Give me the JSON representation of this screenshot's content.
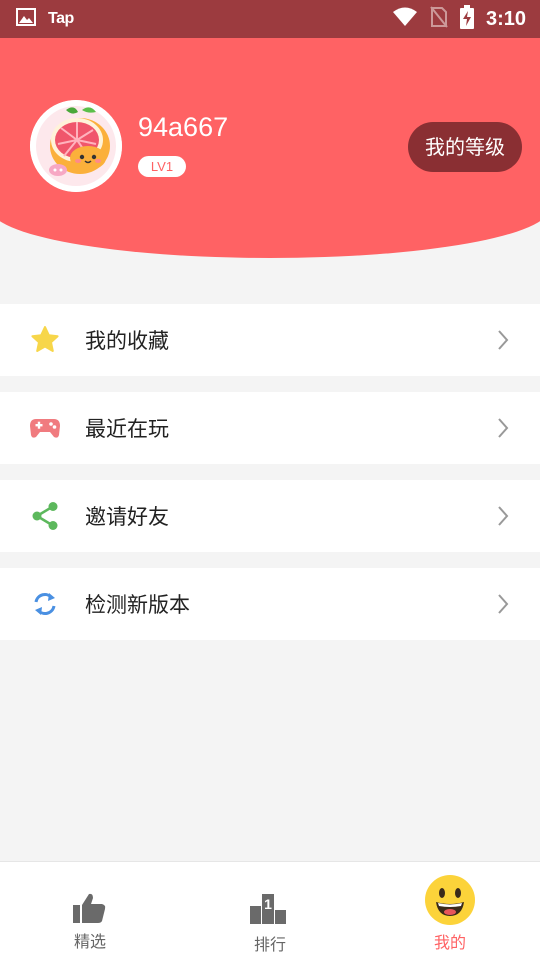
{
  "status_bar": {
    "app_label": "Tap",
    "time": "3:10"
  },
  "profile": {
    "username": "94a667",
    "level": "LV1",
    "level_button_label": "我的等级"
  },
  "menu": {
    "items": [
      {
        "label": "我的收藏",
        "icon": "star-icon"
      },
      {
        "label": "最近在玩",
        "icon": "gamepad-icon"
      },
      {
        "label": "邀请好友",
        "icon": "share-icon"
      },
      {
        "label": "检测新版本",
        "icon": "refresh-icon"
      }
    ]
  },
  "bottom_nav": {
    "tabs": [
      {
        "label": "精选",
        "icon": "thumbs-up-icon"
      },
      {
        "label": "排行",
        "icon": "podium-icon"
      },
      {
        "label": "我的",
        "icon": "smiley-icon",
        "active": true
      }
    ]
  },
  "colors": {
    "primary": "#ff6264",
    "status_bar": "#9c3b3f",
    "level_button": "#8a2f33",
    "star": "#f7d64a",
    "gamepad": "#f07b7f",
    "share": "#5cb85c",
    "refresh": "#4a90e2",
    "nav_active": "#ff6264",
    "nav_inactive": "#666666"
  }
}
